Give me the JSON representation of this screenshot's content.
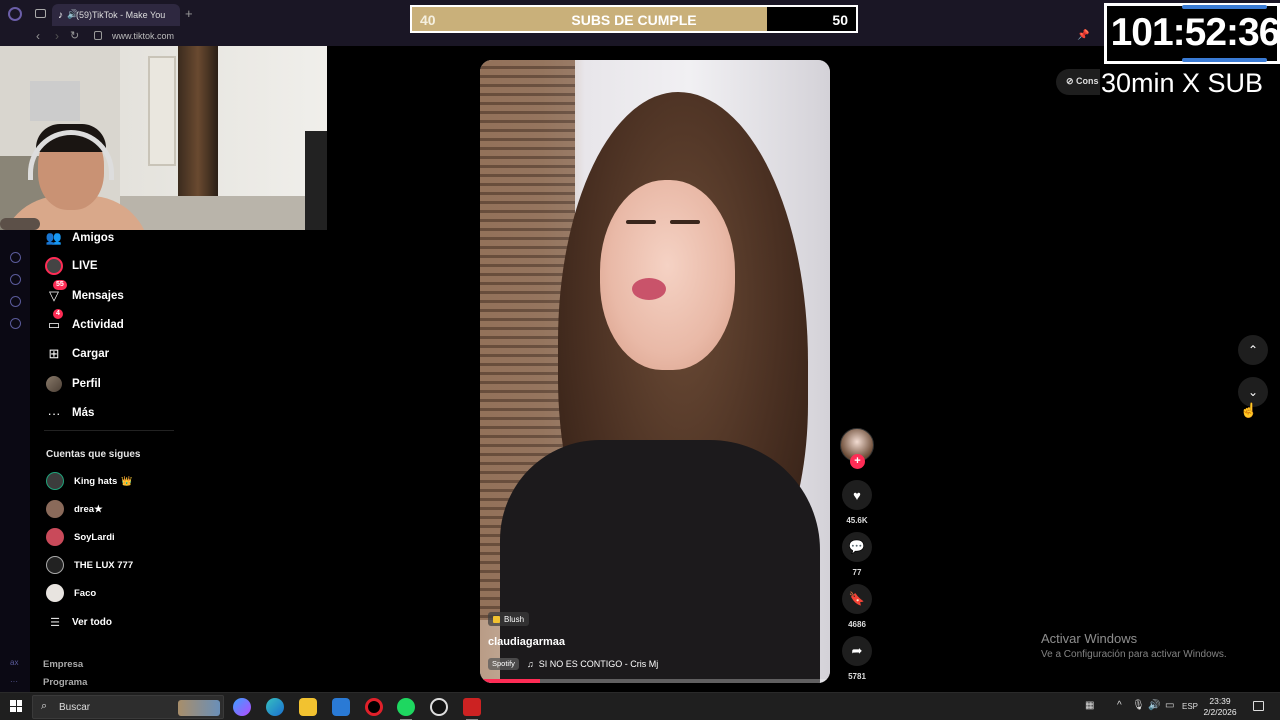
{
  "browser": {
    "tab_title": "(59)TikTok - Make You",
    "tab_icon": "tiktok-icon",
    "url": "www.tiktok.com"
  },
  "sidebar": {
    "items": [
      {
        "label": "Amigos",
        "icon": "friends-icon"
      },
      {
        "label": "LIVE",
        "icon": "live-icon"
      },
      {
        "label": "Mensajes",
        "icon": "messages-icon",
        "badge": "55"
      },
      {
        "label": "Actividad",
        "icon": "activity-icon",
        "badge": "4"
      },
      {
        "label": "Cargar",
        "icon": "upload-icon"
      },
      {
        "label": "Perfil",
        "icon": "profile-icon"
      },
      {
        "label": "Más",
        "icon": "more-icon"
      }
    ],
    "following_title": "Cuentas que sigues",
    "following": [
      {
        "name": "King hats",
        "crown": "👑"
      },
      {
        "name": "drea★"
      },
      {
        "name": "SoyLardi"
      },
      {
        "name": "THE LUX 777"
      },
      {
        "name": "Faco"
      }
    ],
    "see_all": "Ver todo",
    "footer": [
      "Empresa",
      "Programa"
    ]
  },
  "video": {
    "tag": "Blush",
    "username": "claudiagarmaa",
    "music_source": "Spotify",
    "music": "SI NO ES CONTIGO - Cris Mj",
    "progress": 0.17
  },
  "actions": {
    "likes": "45.6K",
    "comments": "77",
    "saves": "4686",
    "shares": "5781"
  },
  "overlay": {
    "subs_left": "40",
    "subs_title": "SUBS DE CUMPLE",
    "subs_right": "50",
    "subs_progress": 0.8,
    "timer": "101:52:36",
    "timer_sub": "30min X SUB",
    "cons_label": "Cons"
  },
  "windows": {
    "activate_title": "Activar Windows",
    "activate_sub": "Ve a Configuración para activar Windows."
  },
  "taskbar": {
    "search": "Buscar",
    "lang": "ESP",
    "time": "23:39",
    "date": "2/2/2026"
  },
  "colors": {
    "tiktok_red": "#fe2c55",
    "subs_fill": "#c9b07a",
    "timer_accent": "#3a7bd5"
  }
}
